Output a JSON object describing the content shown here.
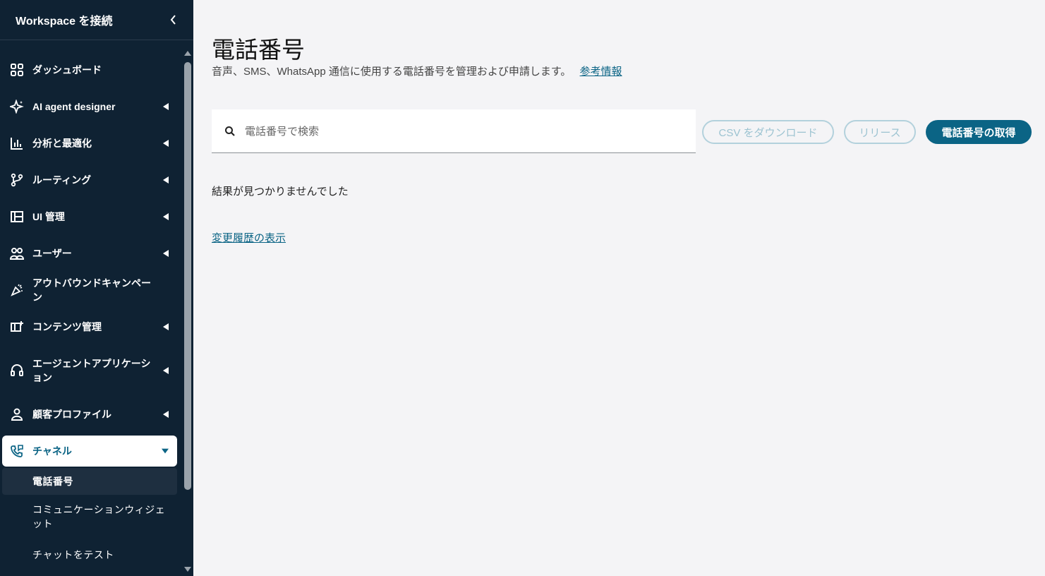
{
  "sidebar": {
    "title": "Workspace を接続",
    "items": [
      {
        "label": "ダッシュボード",
        "icon": "dashboard-icon",
        "caret": false
      },
      {
        "label": "AI agent designer",
        "icon": "sparkle-icon",
        "caret": true
      },
      {
        "label": "分析と最適化",
        "icon": "bar-chart-icon",
        "caret": true
      },
      {
        "label": "ルーティング",
        "icon": "routing-icon",
        "caret": true
      },
      {
        "label": "UI 管理",
        "icon": "layout-icon",
        "caret": true
      },
      {
        "label": "ユーザー",
        "icon": "users-icon",
        "caret": true
      },
      {
        "label": "アウトバウンドキャンペーン",
        "icon": "campaign-icon",
        "caret": false
      },
      {
        "label": "コンテンツ管理",
        "icon": "content-icon",
        "caret": true
      },
      {
        "label": "エージェントアプリケーション",
        "icon": "headset-icon",
        "caret": true
      },
      {
        "label": "顧客プロファイル",
        "icon": "person-icon",
        "caret": true
      },
      {
        "label": "チャネル",
        "icon": "phone-chat-icon",
        "caret": true,
        "active": true
      }
    ],
    "sub_items": [
      {
        "label": "電話番号",
        "selected": true
      },
      {
        "label": "コミュニケーションウィジェット"
      },
      {
        "label": "チャットをテスト"
      }
    ]
  },
  "main": {
    "title": "電話番号",
    "description": "音声、SMS、WhatsApp 通信に使用する電話番号を管理および申請します。",
    "reference_link": "参考情報",
    "search": {
      "placeholder": "電話番号で検索",
      "value": ""
    },
    "buttons": {
      "download_csv": "CSV をダウンロード",
      "release": "リリース",
      "get_number": "電話番号の取得"
    },
    "no_results": "結果が見つかりませんでした",
    "history_link": "変更履歴の表示"
  },
  "colors": {
    "sidebar_bg": "#0f2233",
    "accent": "#0b6485",
    "page_bg": "#f4f4f6"
  }
}
